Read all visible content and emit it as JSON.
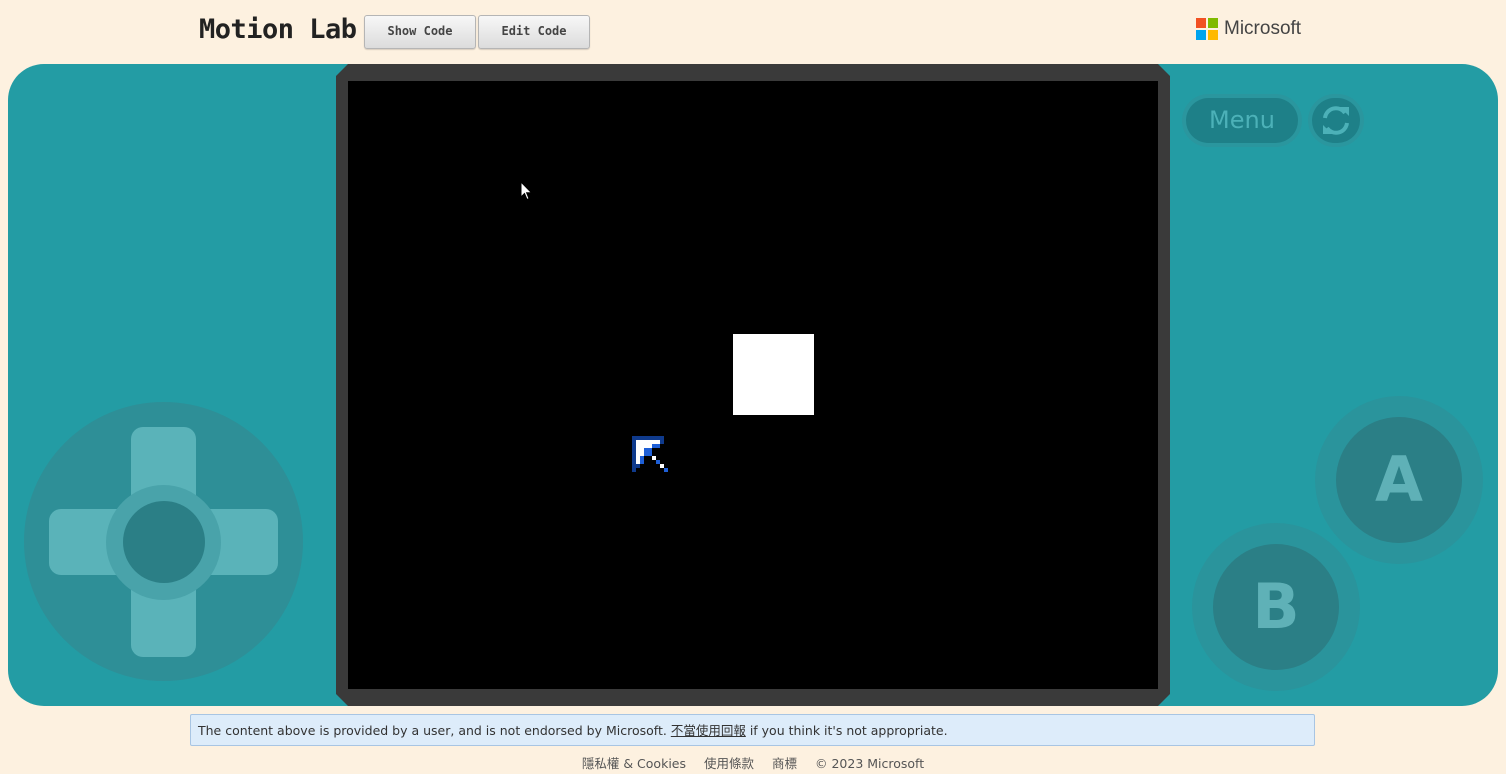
{
  "header": {
    "title": "Motion Lab",
    "show_code_label": "Show Code",
    "edit_code_label": "Edit Code",
    "brand_name": "Microsoft",
    "brand_colors": [
      "#f25022",
      "#7fba00",
      "#00a4ef",
      "#ffb900"
    ]
  },
  "console": {
    "menu_label": "Menu",
    "a_label": "A",
    "b_label": "B",
    "body_color": "#239ca4",
    "screen_color": "#000000"
  },
  "notice": {
    "text_before": "The content above is provided by a user, and is not endorsed by Microsoft.",
    "link_text": "不當使用回報",
    "text_after": "if you think it's not appropriate."
  },
  "footer": {
    "links": [
      "隱私權 & Cookies",
      "使用條款",
      "商標",
      "© 2023 Microsoft"
    ]
  }
}
